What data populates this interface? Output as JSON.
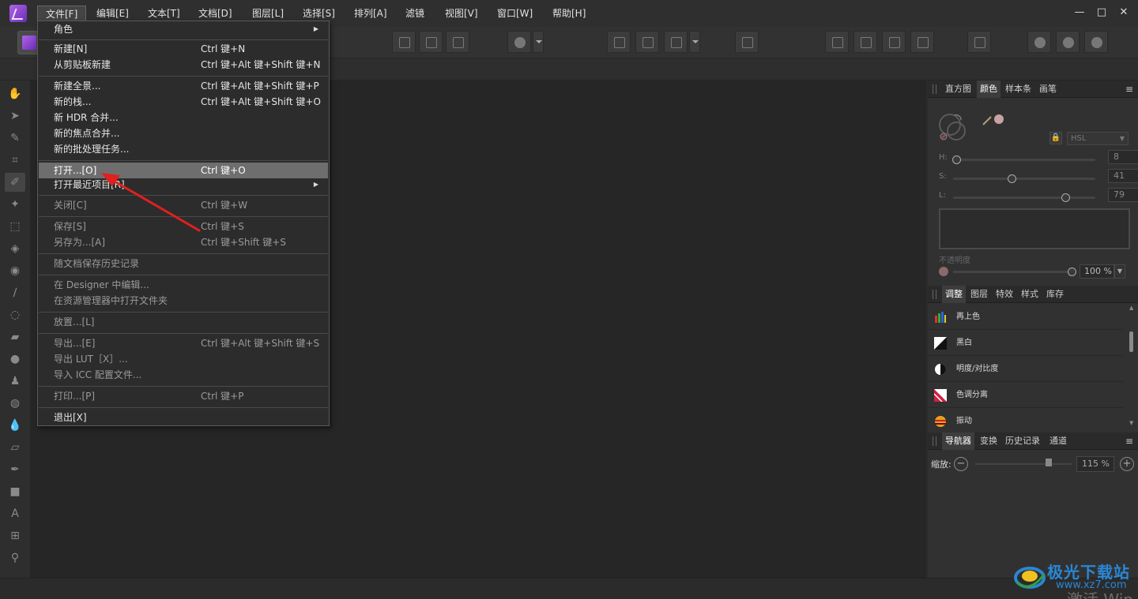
{
  "menubar": {
    "items": [
      "文件[F]",
      "编辑[E]",
      "文本[T]",
      "文档[D]",
      "图层[L]",
      "选择[S]",
      "排列[A]",
      "滤镜",
      "视图[V]",
      "窗口[W]",
      "帮助[H]"
    ],
    "window_controls": {
      "minimize": "—",
      "maximize": "□",
      "close": "✕"
    }
  },
  "file_menu": {
    "items": [
      {
        "label": "角色",
        "shortcut": "",
        "submenu": true
      },
      {
        "label": "新建[N]",
        "shortcut": "Ctrl 键+N"
      },
      {
        "label": "从剪贴板新建",
        "shortcut": "Ctrl 键+Alt 键+Shift 键+N"
      },
      {
        "label": "新建全景...",
        "shortcut": "Ctrl 键+Alt 键+Shift 键+P"
      },
      {
        "label": "新的栈...",
        "shortcut": "Ctrl 键+Alt 键+Shift 键+O"
      },
      {
        "label": "新 HDR 合并...",
        "shortcut": ""
      },
      {
        "label": "新的焦点合并...",
        "shortcut": ""
      },
      {
        "label": "新的批处理任务...",
        "shortcut": ""
      },
      {
        "label": "打开...[O]",
        "shortcut": "Ctrl 键+O"
      },
      {
        "label": "打开最近项目[R]",
        "shortcut": "",
        "submenu": true
      },
      {
        "label": "关闭[C]",
        "shortcut": "Ctrl 键+W"
      },
      {
        "label": "保存[S]",
        "shortcut": "Ctrl 键+S"
      },
      {
        "label": "另存为...[A]",
        "shortcut": "Ctrl 键+Shift 键+S"
      },
      {
        "label": "随文档保存历史记录",
        "shortcut": ""
      },
      {
        "label": "在 Designer 中编辑...",
        "shortcut": ""
      },
      {
        "label": "在资源管理器中打开文件夹",
        "shortcut": ""
      },
      {
        "label": "放置...[L]",
        "shortcut": ""
      },
      {
        "label": "导出...[E]",
        "shortcut": "Ctrl 键+Alt 键+Shift 键+S"
      },
      {
        "label": "导出 LUT［X］...",
        "shortcut": ""
      },
      {
        "label": "导入 ICC 配置文件...",
        "shortcut": ""
      },
      {
        "label": "打印...[P]",
        "shortcut": "Ctrl 键+P"
      },
      {
        "label": "退出[X]",
        "shortcut": ""
      }
    ]
  },
  "color_panel": {
    "tabs": [
      "直方图",
      "颜色",
      "样本条",
      "画笔"
    ],
    "mode": "HSL",
    "h_label": "H:",
    "h_value": "8",
    "h_fraction": 0.02,
    "s_label": "S:",
    "s_value": "41",
    "s_fraction": 0.41,
    "l_label": "L:",
    "l_value": "79",
    "l_fraction": 0.79,
    "opacity_label": "不透明度",
    "opacity_value": "100 %",
    "opacity_fraction": 1.0,
    "swatch_color": "#c9a3a0"
  },
  "adjust_panel": {
    "tabs": [
      "调整",
      "图层",
      "特效",
      "样式",
      "库存"
    ],
    "items": [
      "再上色",
      "黑白",
      "明度/对比度",
      "色调分离",
      "振动"
    ]
  },
  "navigator_panel": {
    "tabs": [
      "导航器",
      "变换",
      "历史记录",
      "通道"
    ],
    "zoom_label": "缩放:",
    "zoom_value": "115 %",
    "zoom_fraction": 0.76
  },
  "watermark": {
    "brand": "极光下载站",
    "url": "www.xz7.com",
    "activate": "激活 Win"
  },
  "colors": {
    "accent_arrow": "#e02020",
    "brand_blue": "#2a87d6"
  }
}
